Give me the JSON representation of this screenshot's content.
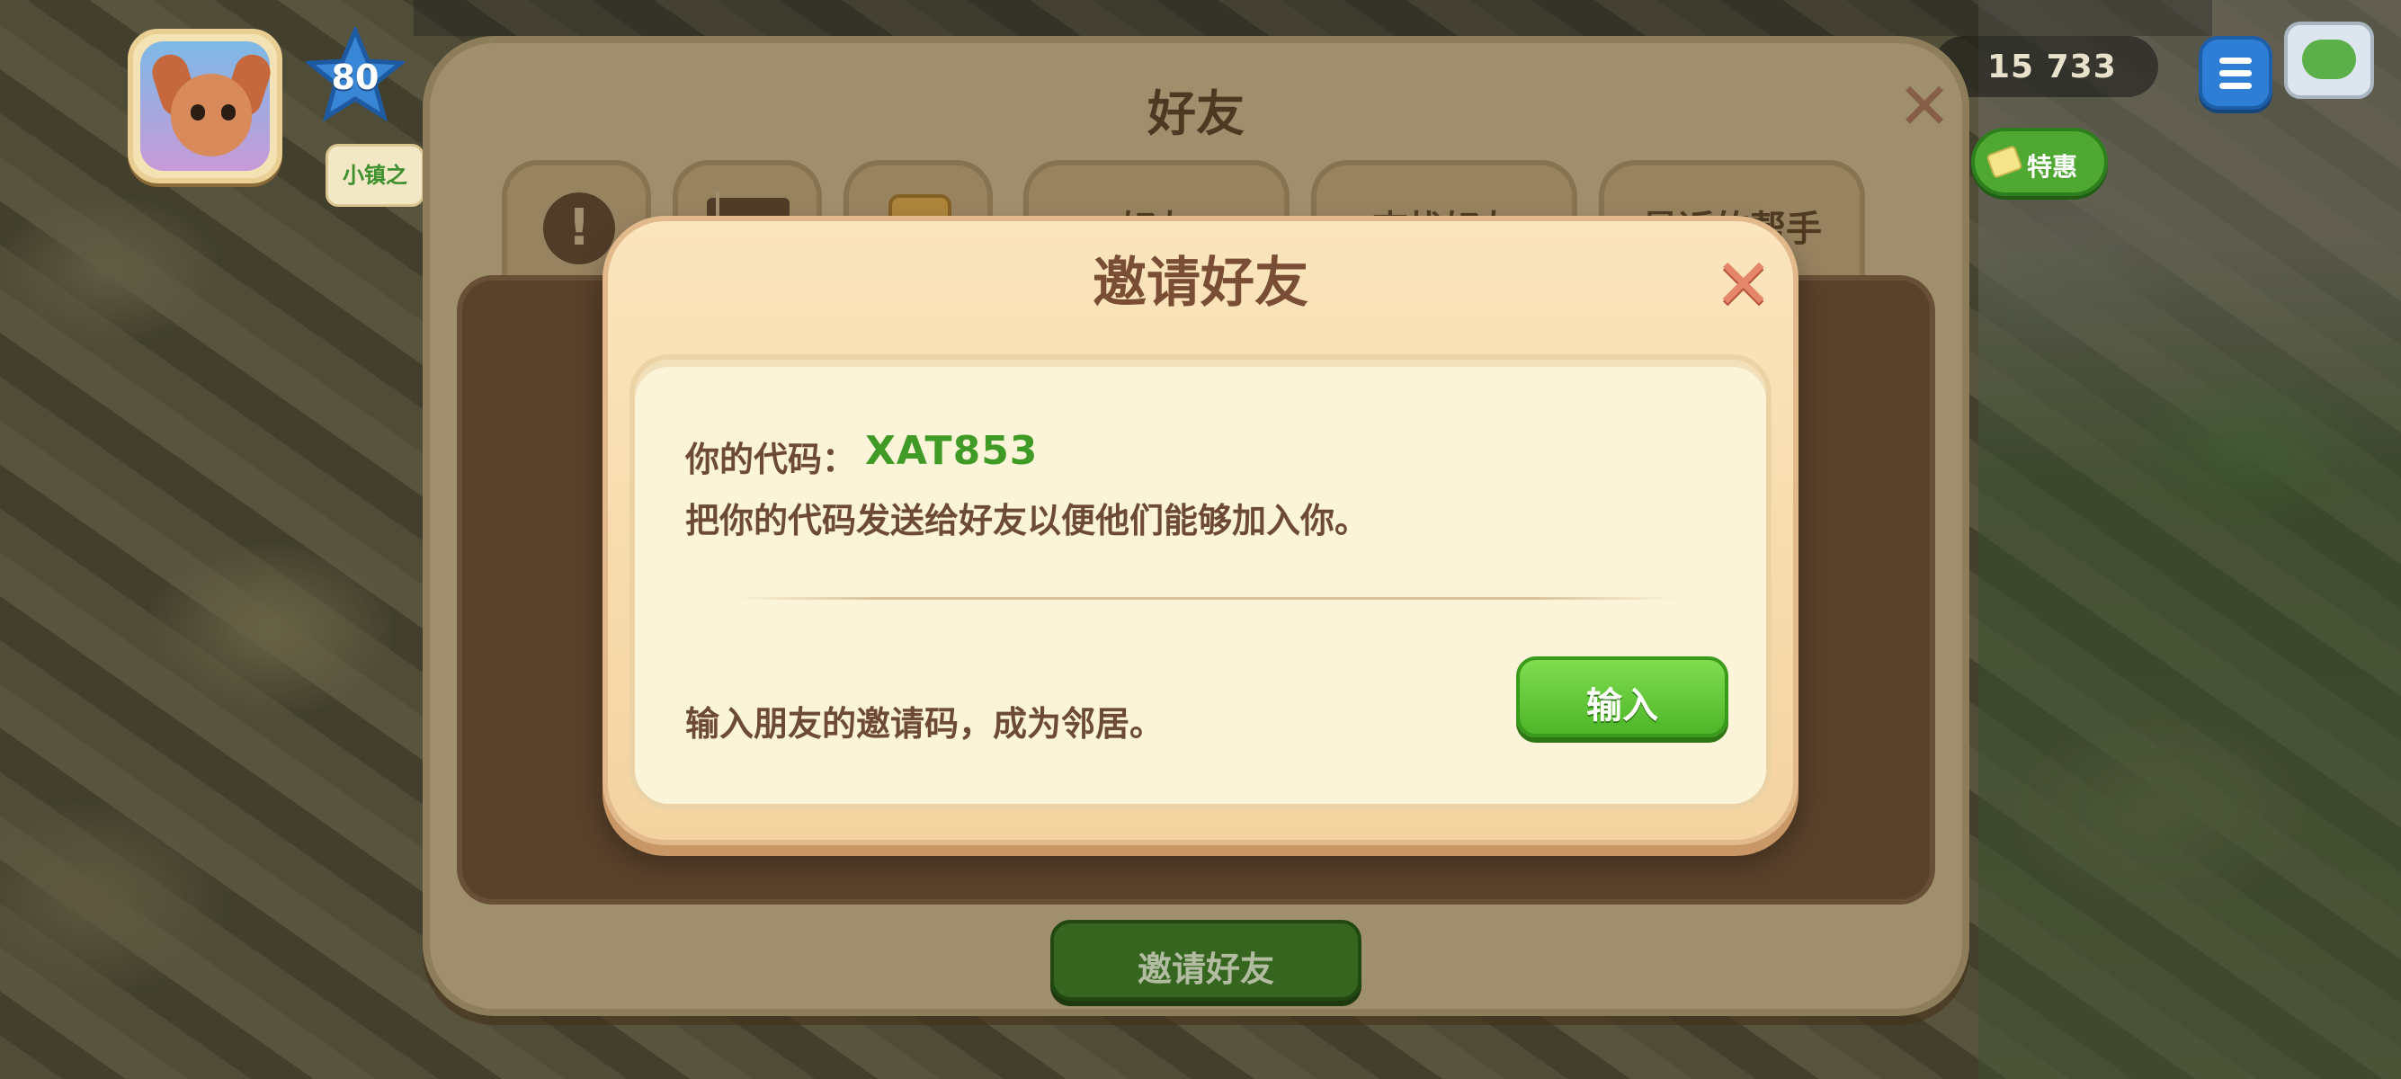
{
  "hud": {
    "level": "80",
    "side_badge": "小镇之",
    "coins": "15 733",
    "special_label": "特惠"
  },
  "friends_panel": {
    "title": "好友",
    "tabs": [
      "好友",
      "查找好友",
      "最近的帮手"
    ],
    "invite_button": "邀请好友"
  },
  "invite_modal": {
    "title": "邀请好友",
    "code_label": "你的代码：",
    "code_value": "XAT853",
    "code_desc": "把你的代码发送给好友以便他们能够加入你。",
    "enter_desc": "输入朋友的邀请码，成为邻居。",
    "enter_button": "输入"
  },
  "colors": {
    "code_green": "#3f9a26",
    "button_green": "#4eb629",
    "modal_bg": "#fcf4d8",
    "text_brown": "#6d4a33"
  },
  "icons": [
    "close-icon",
    "menu-icon",
    "star-icon",
    "alert-icon",
    "mail-icon",
    "gift-icon",
    "cash-icon",
    "chat-icon"
  ]
}
